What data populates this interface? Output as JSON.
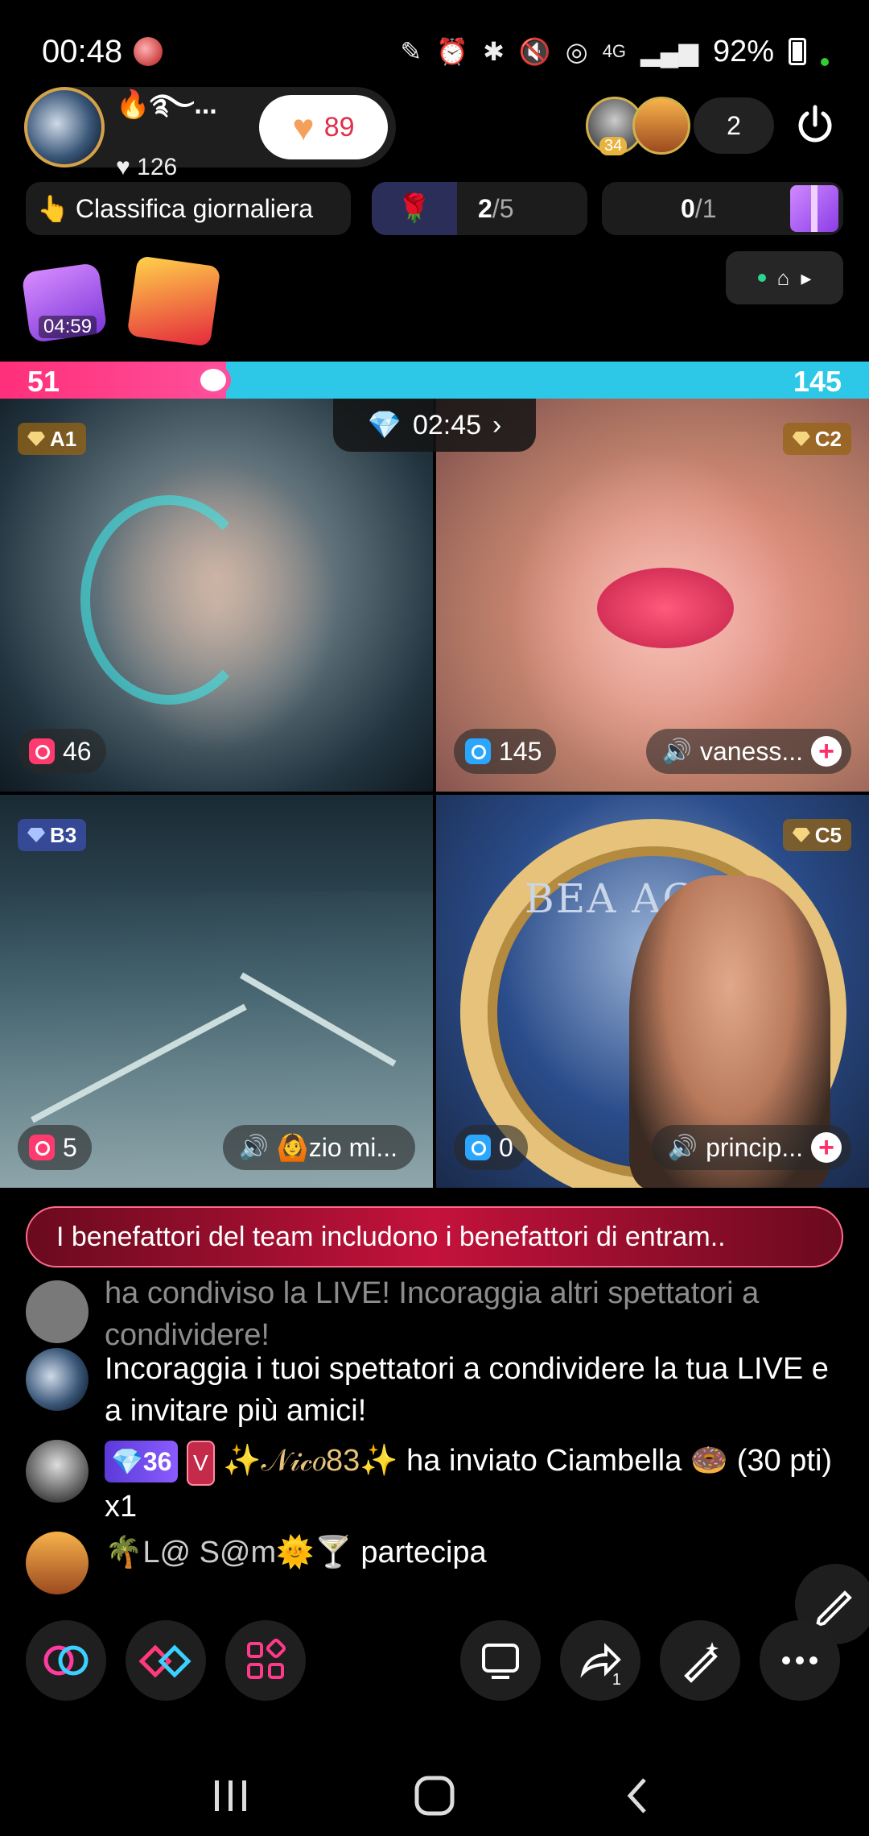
{
  "status_bar": {
    "time": "00:48",
    "network": "4G",
    "battery": "92%"
  },
  "host": {
    "name": "🔥࿐...",
    "likes": "126",
    "hearts": "89"
  },
  "viewers": {
    "badge": "34",
    "count": "2"
  },
  "row2": {
    "ranking_label": "Classifica giornaliera",
    "gift_progress_num": "2",
    "gift_progress_den": "/5",
    "box_progress_num": "0",
    "box_progress_den": "/1"
  },
  "timer_item": "04:59",
  "score": {
    "left": "51",
    "right": "145",
    "left_fraction": 0.26
  },
  "match_timer": "02:45",
  "tiles": [
    {
      "tag": "A1",
      "count": "46",
      "name": ""
    },
    {
      "tag": "C2",
      "count": "145",
      "name": "vaness..."
    },
    {
      "tag": "B3",
      "count": "5",
      "name": "🙆zio mi..."
    },
    {
      "tag": "C5",
      "count": "0",
      "name": "princip..."
    }
  ],
  "tile4_text": "BEA AG",
  "banner": "I benefattori del team includono i benefattori di entram..",
  "chat": [
    {
      "text": "ha condiviso la LIVE! Incoraggia altri spettatori a condividere!"
    },
    {
      "text": "Incoraggia i tuoi spettatori a condividere la tua LIVE e a invitare più amici!"
    },
    {
      "level": "36",
      "vip": "V",
      "user": "✨𝒩𝒾𝒸𝑜83✨",
      "text": "ha inviato Ciambella 🍩 (30 pti) x1"
    },
    {
      "user": "🌴L@ S@m🌞🍸",
      "text": "partecipa"
    }
  ],
  "toolbar": {
    "share_count": "1"
  },
  "colors": {
    "pink": "#ff2f7a",
    "cyan": "#2dc8e8",
    "banner_red": "#c4123c"
  }
}
